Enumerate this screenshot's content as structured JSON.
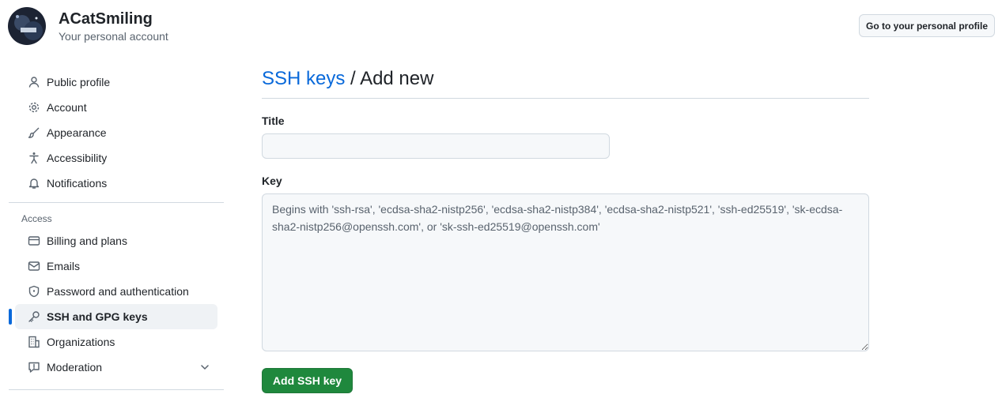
{
  "account": {
    "name": "ACatSmiling",
    "subtitle": "Your personal account",
    "profile_button": "Go to your personal profile"
  },
  "sidebar": {
    "items": [
      {
        "label": "Public profile",
        "icon": "person-icon"
      },
      {
        "label": "Account",
        "icon": "gear-icon"
      },
      {
        "label": "Appearance",
        "icon": "paintbrush-icon"
      },
      {
        "label": "Accessibility",
        "icon": "accessibility-icon"
      },
      {
        "label": "Notifications",
        "icon": "bell-icon"
      }
    ],
    "access_label": "Access",
    "access_items": [
      {
        "label": "Billing and plans",
        "icon": "credit-card-icon"
      },
      {
        "label": "Emails",
        "icon": "mail-icon"
      },
      {
        "label": "Password and authentication",
        "icon": "shield-lock-icon"
      },
      {
        "label": "SSH and GPG keys",
        "icon": "key-icon",
        "active": true
      },
      {
        "label": "Organizations",
        "icon": "organization-icon"
      },
      {
        "label": "Moderation",
        "icon": "report-icon"
      }
    ]
  },
  "main": {
    "breadcrumb_link": "SSH keys",
    "breadcrumb_sep": " / ",
    "title": "Add new",
    "title_label": "Title",
    "title_value": "",
    "key_label": "Key",
    "key_placeholder": "Begins with 'ssh-rsa', 'ecdsa-sha2-nistp256', 'ecdsa-sha2-nistp384', 'ecdsa-sha2-nistp521', 'ssh-ed25519', 'sk-ecdsa-sha2-nistp256@openssh.com', or 'sk-ssh-ed25519@openssh.com'",
    "submit_label": "Add SSH key"
  },
  "colors": {
    "accent": "#0969da",
    "primary_button": "#1f883d",
    "active_bg": "#eff2f5"
  }
}
